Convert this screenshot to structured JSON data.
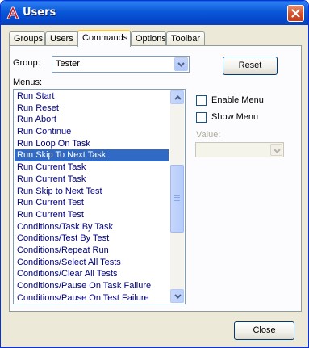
{
  "window": {
    "title": "Users"
  },
  "tabs": [
    {
      "label": "Groups"
    },
    {
      "label": "Users"
    },
    {
      "label": "Commands",
      "active": true
    },
    {
      "label": "Options"
    },
    {
      "label": "Toolbar"
    }
  ],
  "group": {
    "label": "Group:",
    "selected": "Tester"
  },
  "reset_button": {
    "label": "Reset"
  },
  "menus": {
    "label": "Menus:",
    "selected_index": 5,
    "items": [
      "Run Start",
      "Run Reset",
      "Run Abort",
      "Run Continue",
      "Run Loop On Task",
      "Run Skip To Next Task",
      "Run Current Task",
      "Run Current Task",
      "Run Skip to Next Test",
      "Run Current Test",
      "Run Current Test",
      "Conditions/Task By Task",
      "Conditions/Test By Test",
      "Conditions/Repeat Run",
      "Conditions/Select All Tests",
      "Conditions/Clear All Tests",
      "Conditions/Pause On Task Failure",
      "Conditions/Pause On Test Failure"
    ]
  },
  "options": {
    "enable_menu": {
      "label": "Enable Menu",
      "checked": false
    },
    "show_menu": {
      "label": "Show Menu",
      "checked": false
    },
    "value": {
      "label": "Value:",
      "selected": ""
    }
  },
  "close_button": {
    "label": "Close"
  },
  "colors": {
    "titlebar": "#0a58d8",
    "selection": "#316ac5",
    "item_text": "#000080",
    "face": "#ece9d8"
  },
  "icons": {
    "app": "red-a-logo-icon",
    "close": "close-icon",
    "dropdown": "chevron-down-icon"
  }
}
